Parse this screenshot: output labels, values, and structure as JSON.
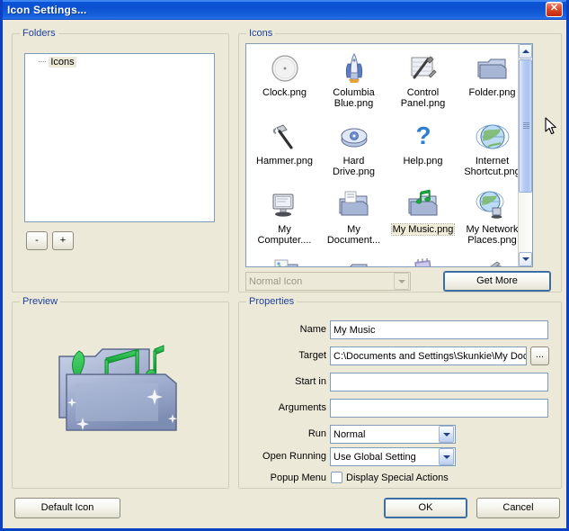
{
  "window": {
    "title": "Icon Settings...",
    "close_label": "✕",
    "accent": "#0a41c4",
    "face": "#ece9d8",
    "legend_color": "#20429c"
  },
  "folders": {
    "legend": "Folders",
    "tree": [
      {
        "label": "Icons",
        "selected": true
      }
    ],
    "remove_button": "-",
    "add_button": "+"
  },
  "icons_panel": {
    "legend": "Icons",
    "items": [
      {
        "name": "Clock.png",
        "art": "clock",
        "selected": false
      },
      {
        "name": "Columbia Blue.png",
        "art": "shuttle",
        "selected": false
      },
      {
        "name": "Control Panel.png",
        "art": "control-panel",
        "selected": false
      },
      {
        "name": "Folder.png",
        "art": "folder",
        "selected": false
      },
      {
        "name": "Hammer.png",
        "art": "hammer",
        "selected": false
      },
      {
        "name": "Hard Drive.png",
        "art": "hard-drive",
        "selected": false
      },
      {
        "name": "Help.png",
        "art": "help",
        "selected": false
      },
      {
        "name": "Internet Shortcut.png",
        "art": "globe",
        "selected": false
      },
      {
        "name": "My Computer....",
        "art": "my-computer",
        "selected": false
      },
      {
        "name": "My Document...",
        "art": "my-documents",
        "selected": false
      },
      {
        "name": "My Music.png",
        "art": "my-music",
        "selected": true
      },
      {
        "name": "My Network Places.png",
        "art": "network-places",
        "selected": false
      },
      {
        "name": "",
        "art": "my-pictures",
        "selected": false
      },
      {
        "name": "",
        "art": "recycle-folder",
        "selected": false
      },
      {
        "name": "",
        "art": "notepad",
        "selected": false
      },
      {
        "name": "",
        "art": "printer",
        "selected": false
      }
    ],
    "icon_type_combo": {
      "value": "Normal Icon",
      "disabled": true
    },
    "get_more_button": "Get More"
  },
  "preview": {
    "legend": "Preview",
    "art": "my-music-folder"
  },
  "properties": {
    "legend": "Properties",
    "fields": [
      {
        "label": "Name",
        "value": "My Music",
        "placeholder": "",
        "type": "text"
      },
      {
        "label": "Target",
        "value": "C:\\Documents and Settings\\Skunkie\\My Doc",
        "placeholder": "",
        "type": "text-browse"
      },
      {
        "label": "Start in",
        "value": "",
        "placeholder": "",
        "type": "text"
      },
      {
        "label": "Arguments",
        "value": "",
        "placeholder": "",
        "type": "text"
      }
    ],
    "browse_button": "...",
    "run": {
      "label": "Run",
      "value": "Normal"
    },
    "open_running": {
      "label": "Open Running",
      "value": "Use Global Setting"
    },
    "popup_menu": {
      "label": "Popup Menu",
      "checkbox_label": "Display Special Actions",
      "checked": false
    }
  },
  "footer": {
    "default_icon_button": "Default Icon",
    "ok_button": "OK",
    "cancel_button": "Cancel"
  }
}
